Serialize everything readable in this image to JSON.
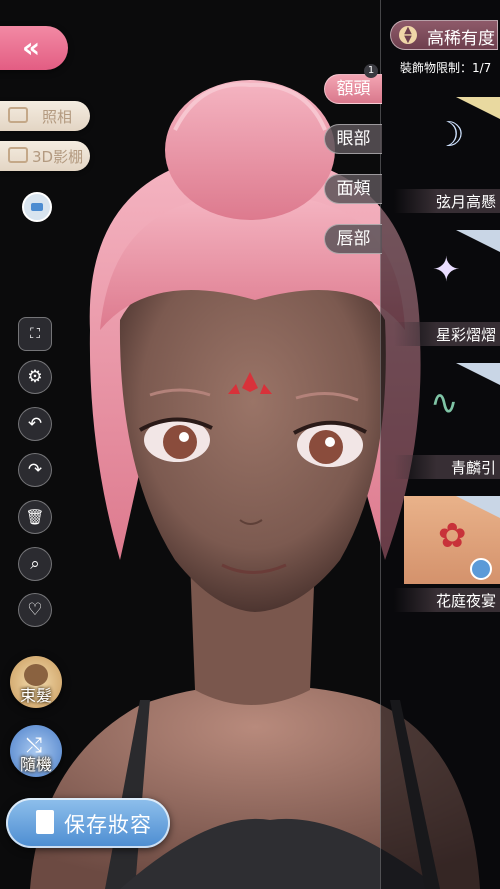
{
  "scene": {
    "description_hidden": ""
  },
  "left": {
    "back_label": "«",
    "photo_label": "照相",
    "studio_label": "3D影棚",
    "tools": [
      "⛶",
      "⚙",
      "↶",
      "↷",
      "🗑",
      "⌕",
      "♡"
    ],
    "hair_label": "束髮",
    "random_label": "隨機",
    "save_label": "保存妝容"
  },
  "categories": {
    "badge": "1",
    "items": [
      {
        "label": "額頭",
        "active": true
      },
      {
        "label": "眼部",
        "active": false
      },
      {
        "label": "面頰",
        "active": false
      },
      {
        "label": "唇部",
        "active": false
      }
    ]
  },
  "panel": {
    "rarity_label": "高稀有度",
    "limit_label": "裝飾物限制：1/7",
    "items": [
      {
        "name": "弦月高懸",
        "icon": "moon-ornament-icon",
        "glyph": "☽"
      },
      {
        "name": "星彩熠熠",
        "icon": "star-sparkle-icon",
        "glyph": "✦"
      },
      {
        "name": "青麟引",
        "icon": "serpent-icon",
        "glyph": "∿"
      },
      {
        "name": "花庭夜宴",
        "icon": "lotus-icon",
        "glyph": "✿"
      }
    ]
  },
  "colors": {
    "hair": "#f29bab",
    "accent_pink": "#e35d83",
    "save_blue": "#5b9ad8",
    "panel_bg": "#1a1a1e"
  }
}
